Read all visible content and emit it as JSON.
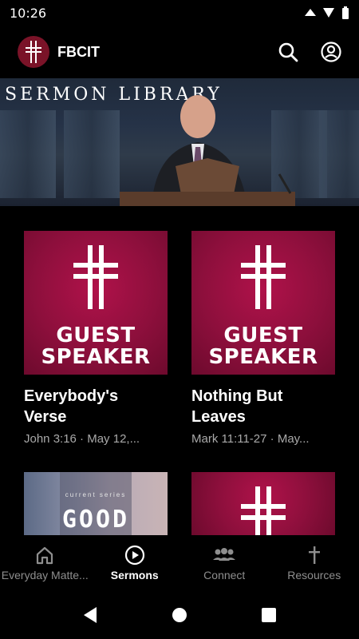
{
  "status": {
    "time": "10:26"
  },
  "app": {
    "title": "FBCIT"
  },
  "hero": {
    "title": "SERMON LIBRARY"
  },
  "sermons": [
    {
      "title_line1": "Everybody's",
      "title_line2": "Verse",
      "subtitle": "John 3:16 · May 12,...",
      "thumb_line1": "GUEST",
      "thumb_line2": "SPEAKER"
    },
    {
      "title_line1": "Nothing But",
      "title_line2": "Leaves",
      "subtitle": "Mark 11:11-27 · May...",
      "thumb_line1": "GUEST",
      "thumb_line2": "SPEAKER"
    },
    {
      "thumb_series": "current series",
      "thumb_word": "GOOD"
    }
  ],
  "nav": {
    "items": [
      {
        "label": "Everyday Matte...",
        "icon": "home-icon"
      },
      {
        "label": "Sermons",
        "icon": "play-circle-icon"
      },
      {
        "label": "Connect",
        "icon": "people-icon"
      },
      {
        "label": "Resources",
        "icon": "cross-icon"
      }
    ]
  },
  "colors": {
    "accent": "#8d0f3c",
    "background": "#000000",
    "muted": "#a9a9a9"
  }
}
